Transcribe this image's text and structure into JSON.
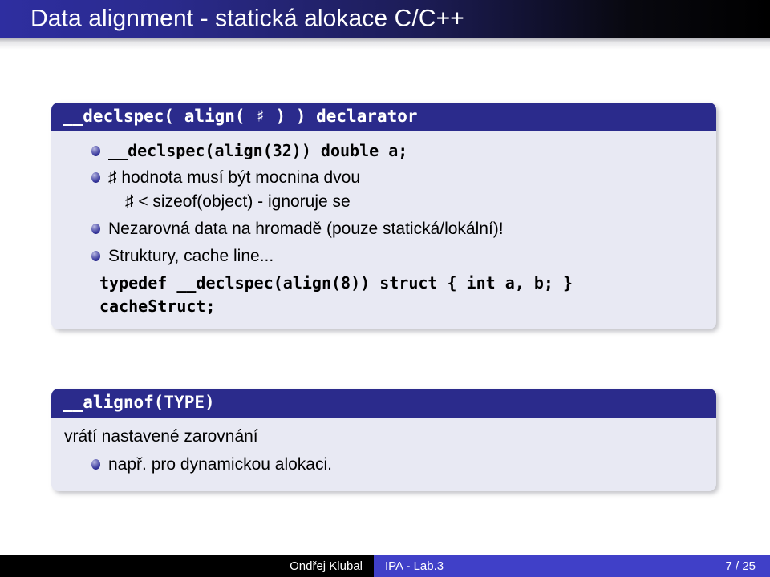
{
  "slide": {
    "title": "Data alignment - statická alokace C/C++"
  },
  "blocks": [
    {
      "header": "__declspec( align( ♯ ) ) declarator",
      "items": [
        {
          "text": "__declspec(align(32)) double a;",
          "style": "mono"
        },
        {
          "text": "♯ hodnota musí být mocnina dvou",
          "style": "prose",
          "sub": "♯ < sizeof(object) - ignoruje se"
        },
        {
          "text": "Nezarovná data na hromadě (pouze statická/lokální)!",
          "style": "prose"
        },
        {
          "text": "Struktury, cache line...",
          "style": "prose"
        }
      ],
      "code_lines": [
        "typedef __declspec(align(8)) struct { int a, b; }",
        "cacheStruct;"
      ]
    },
    {
      "header": "__alignof(TYPE)",
      "plain": "vrátí nastavené zarovnání",
      "items": [
        {
          "text": "např. pro dynamickou alokaci.",
          "style": "prose"
        }
      ]
    }
  ],
  "footer": {
    "author": "Ondřej Klubal",
    "course": "IPA - Lab.3",
    "page": "7 / 25"
  },
  "colors": {
    "title_blue": "#2e2ea0",
    "block_header": "#2b2b8c",
    "block_body": "#e8e9f3",
    "footer_blue": "#4040c8",
    "footer_black": "#000000"
  }
}
